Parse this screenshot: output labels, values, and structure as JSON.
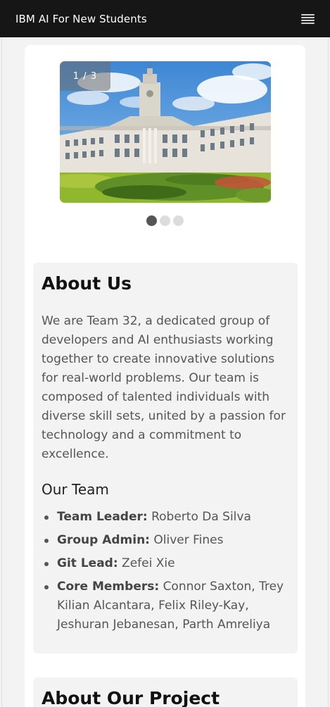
{
  "header": {
    "title": "IBM AI For New Students",
    "menu_icon": "hamburger-menu-icon"
  },
  "carousel": {
    "counter": "1 / 3",
    "slide_count": 3,
    "active_index": 0,
    "image": "university-building-photo"
  },
  "about": {
    "heading": "About Us",
    "text": "We are Team 32, a dedicated group of developers and AI enthusiasts working together to create innovative solutions for real-world problems. Our team is composed of talented individuals with diverse skill sets, united by a passion for technology and a commitment to excellence.",
    "team_heading": "Our Team",
    "members": [
      {
        "role": "Team Leader:",
        "name": "Roberto Da Silva"
      },
      {
        "role": "Group Admin:",
        "name": "Oliver Fines"
      },
      {
        "role": "Git Lead:",
        "name": "Zefei Xie"
      },
      {
        "role": "Core Members:",
        "name": "Connor Saxton, Trey Kilian Alcantara, Felix Riley-Kay, Jeshuran Jebanesan, Parth Amreliya"
      }
    ]
  },
  "project": {
    "heading": "About Our Project"
  }
}
